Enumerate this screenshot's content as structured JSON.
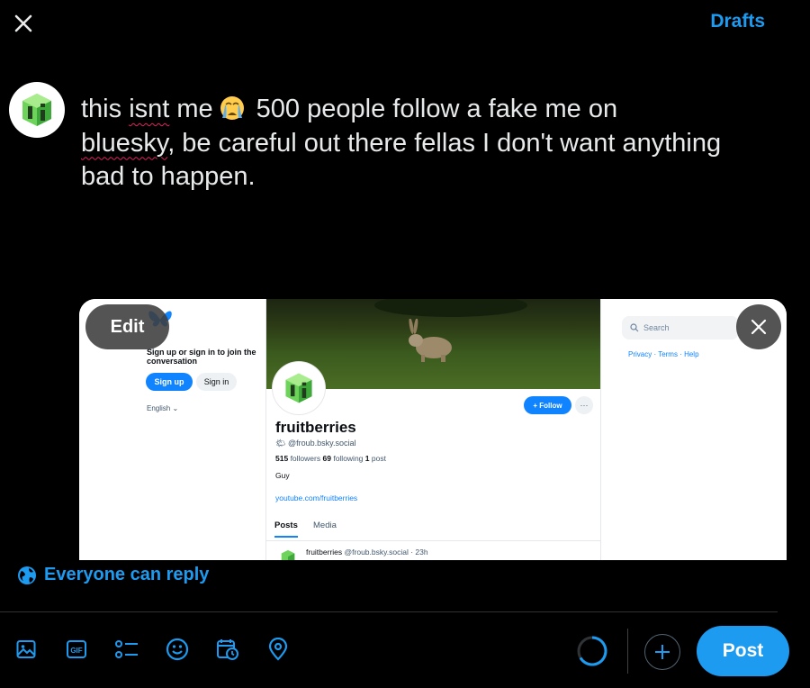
{
  "header": {
    "drafts_label": "Drafts"
  },
  "compose": {
    "text_part1": "this ",
    "text_isnt": "isnt",
    "text_part2": " me",
    "text_part3": "500 people follow a fake me on",
    "text_bluesky": "bluesky",
    "text_part4": ", be careful out there fellas I don't want anything bad to happen.",
    "emoji": "crying-face"
  },
  "media": {
    "edit_label": "Edit",
    "screenshot": {
      "join_text": "Sign up or sign in to join the conversation",
      "signup_label": "Sign up",
      "signin_label": "Sign in",
      "language": "English",
      "follow_label": "+ Follow",
      "more_label": "···",
      "profile_name": "fruitberries",
      "handle": "@froub.bsky.social",
      "followers_count": "515",
      "followers_label": "followers",
      "following_count": "69",
      "following_label": "following",
      "posts_count": "1",
      "posts_label": "post",
      "bio": "Guy",
      "link": "youtube.com/fruitberries",
      "tab_posts": "Posts",
      "tab_media": "Media",
      "post_author": "fruitberries",
      "post_meta": "@froub.bsky.social · 23h",
      "search_placeholder": "Search",
      "footer_links": "Privacy · Terms · Help"
    }
  },
  "reply_setting": "Everyone can reply",
  "actions": {
    "post_label": "Post"
  },
  "colors": {
    "accent": "#1d9bf0",
    "background": "#000000",
    "text": "#e7e9ea"
  }
}
